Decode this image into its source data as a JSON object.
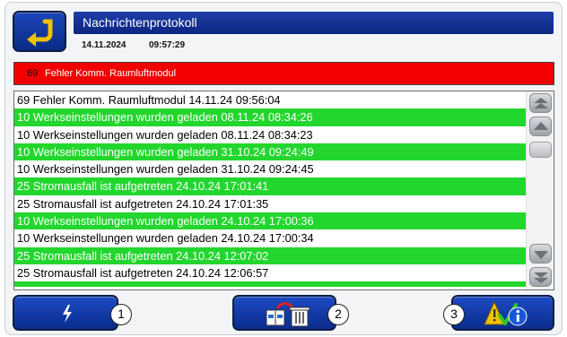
{
  "header": {
    "title": "Nachrichtenprotokoll",
    "date": "14.11.2024",
    "time": "09:57:29"
  },
  "alarm": {
    "code": "69",
    "text": "Fehler Komm. Raumluftmodul"
  },
  "log": {
    "entries": [
      {
        "text": "69 Fehler Komm. Raumluftmodul 14.11.24 09:56:04",
        "highlighted": false
      },
      {
        "text": "10 Werkseinstellungen wurden geladen 08.11.24 08:34:26",
        "highlighted": true
      },
      {
        "text": "10 Werkseinstellungen wurden geladen 08.11.24 08:34:23",
        "highlighted": false
      },
      {
        "text": "10 Werkseinstellungen wurden geladen 31.10.24 09:24:49",
        "highlighted": true
      },
      {
        "text": "10 Werkseinstellungen wurden geladen 31.10.24 09:24:45",
        "highlighted": false
      },
      {
        "text": "25 Stromausfall ist aufgetreten 24.10.24 17:01:41",
        "highlighted": true
      },
      {
        "text": "25 Stromausfall ist aufgetreten 24.10.24 17:01:35",
        "highlighted": false
      },
      {
        "text": "10 Werkseinstellungen wurden geladen 24.10.24 17:00:36",
        "highlighted": true
      },
      {
        "text": "10 Werkseinstellungen wurden geladen 24.10.24 17:00:34",
        "highlighted": false
      },
      {
        "text": "25 Stromausfall ist aufgetreten 24.10.24 12:07:02",
        "highlighted": true
      },
      {
        "text": "25 Stromausfall ist aufgetreten 24.10.24 12:06:57",
        "highlighted": false
      }
    ]
  },
  "footer": {
    "badge1": "1",
    "badge2": "2",
    "badge3": "3"
  },
  "colors": {
    "highlight": "#23d62e",
    "alarm": "#f20000",
    "title_bar": "#0b2580"
  },
  "icons": {
    "back": "return-arrow-icon",
    "button1": "lightning-icon",
    "button2": "archive-delete-icon",
    "button3": "warning-info-icon"
  }
}
